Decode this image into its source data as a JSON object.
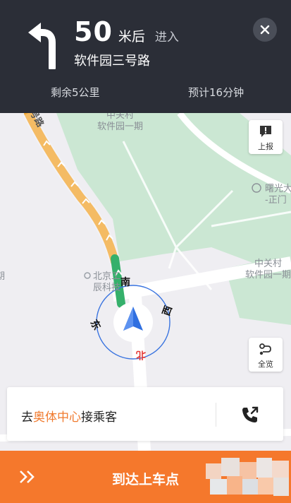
{
  "navigation": {
    "distance_value": "50",
    "distance_unit": "米后",
    "action": "进入",
    "road_name": "软件园三号路",
    "remaining_distance": "剩余5公里",
    "estimated_time": "预计16分钟"
  },
  "map": {
    "labels": {
      "zgc_park1_line1": "中关村",
      "zgc_park1_line2": "软件园一期",
      "zgc_right_line1": "中关村",
      "zgc_right_line2": "软件园一期",
      "shuguang_line1": "曙光大",
      "shuguang_line2": "-正门",
      "beijing_line1": "北京工",
      "beijing_line2": "辰科技",
      "road_fragment": "号路",
      "edge_fragment": "期"
    },
    "compass": {
      "north": "北",
      "south": "南",
      "east": "东",
      "west": "西"
    },
    "report_button_label": "上报",
    "overview_button_label": "全览"
  },
  "passenger_card": {
    "prefix": "去",
    "destination": "奥体中心",
    "suffix": "接乘客"
  },
  "action_bar": {
    "label": "到达上车点"
  },
  "colors": {
    "nav_background": "#2b2e37",
    "accent_orange": "#f5782c",
    "route_yellow": "#f0a531",
    "route_green": "#35b06b",
    "park_green": "#cbe7d3",
    "position_blue": "#2f6fe0"
  }
}
